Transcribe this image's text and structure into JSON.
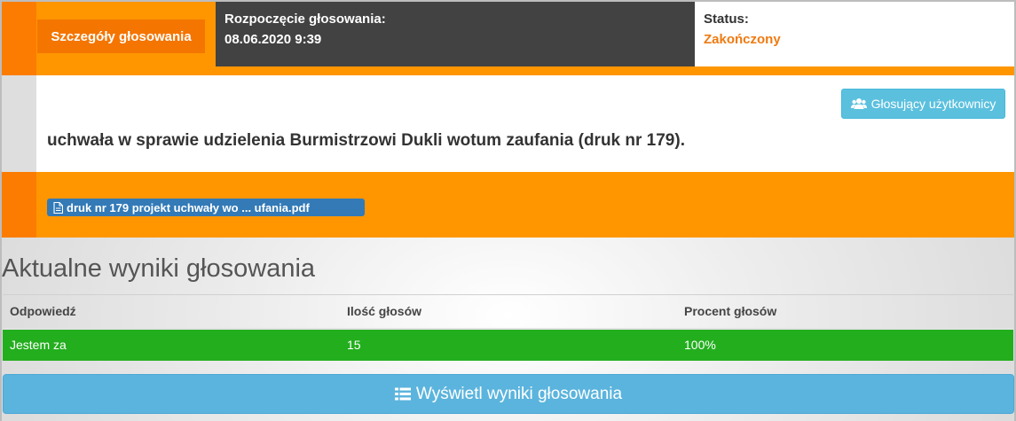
{
  "header": {
    "details_label": "Szczegóły głosowania",
    "start_label": "Rozpoczęcie głosowania:",
    "start_value": "08.06.2020 9:39",
    "status_label": "Status:",
    "status_value": "Zakończony",
    "status_color": "#ef7a10"
  },
  "voting": {
    "users_button_label": "Głosujący użytkownicy",
    "users_icon": "users-icon",
    "title": "uchwała w sprawie udzielenia Burmistrzowi Dukli wotum zaufania (druk nr 179).",
    "attachment_label": "druk nr 179 projekt uchwały wo ... ufania.pdf",
    "attachment_icon": "file-icon"
  },
  "results": {
    "heading": "Aktualne wyniki głosowania",
    "columns": [
      "Odpowiedź",
      "Ilość głosów",
      "Procent głosów"
    ],
    "rows": [
      {
        "answer": "Jestem za",
        "votes": "15",
        "percent": "100%"
      }
    ],
    "row_color": "#23ae1e",
    "show_button_label": "Wyświetl wyniki głosowania",
    "show_button_icon": "list-icon"
  },
  "colors": {
    "accent_orange": "#ff9600",
    "dark": "#424242",
    "info_blue": "#5bc0de",
    "primary_blue": "#337ab7"
  }
}
